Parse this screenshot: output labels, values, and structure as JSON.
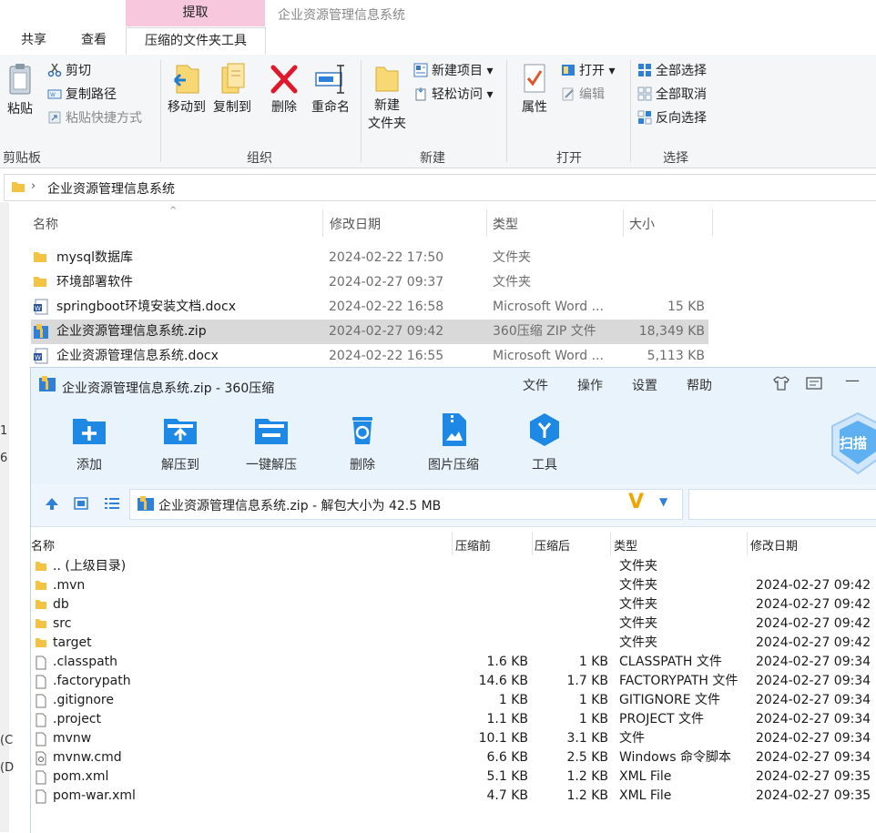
{
  "ribbon": {
    "context_tab_group": "提取",
    "window_title": "企业资源管理信息系统",
    "tabs": [
      "共享",
      "查看",
      "压缩的文件夹工具"
    ],
    "clipboard": {
      "paste": "粘贴",
      "cut": "剪切",
      "copy_path": "复制路径",
      "paste_shortcut": "粘贴快捷方式",
      "label": "剪贴板"
    },
    "organize": {
      "move_to": "移动到",
      "copy_to": "复制到",
      "delete": "删除",
      "rename": "重命名",
      "label": "组织"
    },
    "new": {
      "new_folder_line1": "新建",
      "new_folder_line2": "文件夹",
      "new_item": "新建项目",
      "easy_access": "轻松访问",
      "label": "新建"
    },
    "open": {
      "properties": "属性",
      "open": "打开",
      "edit": "编辑",
      "label": "打开"
    },
    "select": {
      "select_all": "全部选择",
      "select_none": "全部取消",
      "invert": "反向选择",
      "label": "选择"
    }
  },
  "address": {
    "path": "企业资源管理信息系统"
  },
  "explorer": {
    "columns": [
      "名称",
      "修改日期",
      "类型",
      "大小"
    ],
    "files": [
      {
        "name": "mysql数据库",
        "date": "2024-02-22 17:50",
        "type": "文件夹",
        "size": ""
      },
      {
        "name": "环境部署软件",
        "date": "2024-02-27 09:37",
        "type": "文件夹",
        "size": ""
      },
      {
        "name": "springboot环境安装文档.docx",
        "date": "2024-02-22 16:58",
        "type": "Microsoft Word ...",
        "size": "15 KB"
      },
      {
        "name": "企业资源管理信息系统.zip",
        "date": "2024-02-27 09:42",
        "type": "360压缩 ZIP 文件",
        "size": "18,349 KB"
      },
      {
        "name": "企业资源管理信息系统.docx",
        "date": "2024-02-22 16:55",
        "type": "Microsoft Word ...",
        "size": "5,113 KB"
      }
    ],
    "left_pane_chars": [
      "1",
      "6",
      "(C",
      "(D"
    ]
  },
  "zip": {
    "title": "企业资源管理信息系统.zip - 360压缩",
    "menu": [
      "文件",
      "操作",
      "设置",
      "帮助"
    ],
    "toolbar": [
      "添加",
      "解压到",
      "一键解压",
      "删除",
      "图片压缩",
      "工具"
    ],
    "scan_label": "扫描",
    "path": "企业资源管理信息系统.zip - 解包大小为 42.5 MB",
    "columns": [
      "名称",
      "压缩前",
      "压缩后",
      "类型",
      "修改日期"
    ],
    "entries": [
      {
        "name": ".. (上级目录)",
        "before": "",
        "after": "",
        "type": "文件夹",
        "date": "",
        "kind": "folder"
      },
      {
        "name": ".mvn",
        "before": "",
        "after": "",
        "type": "文件夹",
        "date": "2024-02-27 09:42",
        "kind": "folder"
      },
      {
        "name": "db",
        "before": "",
        "after": "",
        "type": "文件夹",
        "date": "2024-02-27 09:42",
        "kind": "folder"
      },
      {
        "name": "src",
        "before": "",
        "after": "",
        "type": "文件夹",
        "date": "2024-02-27 09:42",
        "kind": "folder"
      },
      {
        "name": "target",
        "before": "",
        "after": "",
        "type": "文件夹",
        "date": "2024-02-27 09:42",
        "kind": "folder"
      },
      {
        "name": ".classpath",
        "before": "1.6 KB",
        "after": "1 KB",
        "type": "CLASSPATH 文件",
        "date": "2024-02-27 09:34",
        "kind": "file"
      },
      {
        "name": ".factorypath",
        "before": "14.6 KB",
        "after": "1.7 KB",
        "type": "FACTORYPATH 文件",
        "date": "2024-02-27 09:34",
        "kind": "file"
      },
      {
        "name": ".gitignore",
        "before": "1 KB",
        "after": "1 KB",
        "type": "GITIGNORE 文件",
        "date": "2024-02-27 09:34",
        "kind": "file"
      },
      {
        "name": ".project",
        "before": "1.1 KB",
        "after": "1 KB",
        "type": "PROJECT 文件",
        "date": "2024-02-27 09:34",
        "kind": "file"
      },
      {
        "name": "mvnw",
        "before": "10.1 KB",
        "after": "3.1 KB",
        "type": "文件",
        "date": "2024-02-27 09:34",
        "kind": "file"
      },
      {
        "name": "mvnw.cmd",
        "before": "6.6 KB",
        "after": "2.5 KB",
        "type": "Windows 命令脚本",
        "date": "2024-02-27 09:34",
        "kind": "cmd"
      },
      {
        "name": "pom.xml",
        "before": "5.1 KB",
        "after": "1.2 KB",
        "type": "XML File",
        "date": "2024-02-27 09:35",
        "kind": "file"
      },
      {
        "name": "pom-war.xml",
        "before": "4.7 KB",
        "after": "1.2 KB",
        "type": "XML File",
        "date": "2024-02-27 09:35",
        "kind": "file"
      }
    ]
  },
  "colors": {
    "context_tab": "#f7c7dd",
    "selected_row": "#d9d9d9",
    "zip_header": "#e9f3fc",
    "accent_blue": "#1e88e5",
    "folder_yellow": "#f5c342"
  }
}
